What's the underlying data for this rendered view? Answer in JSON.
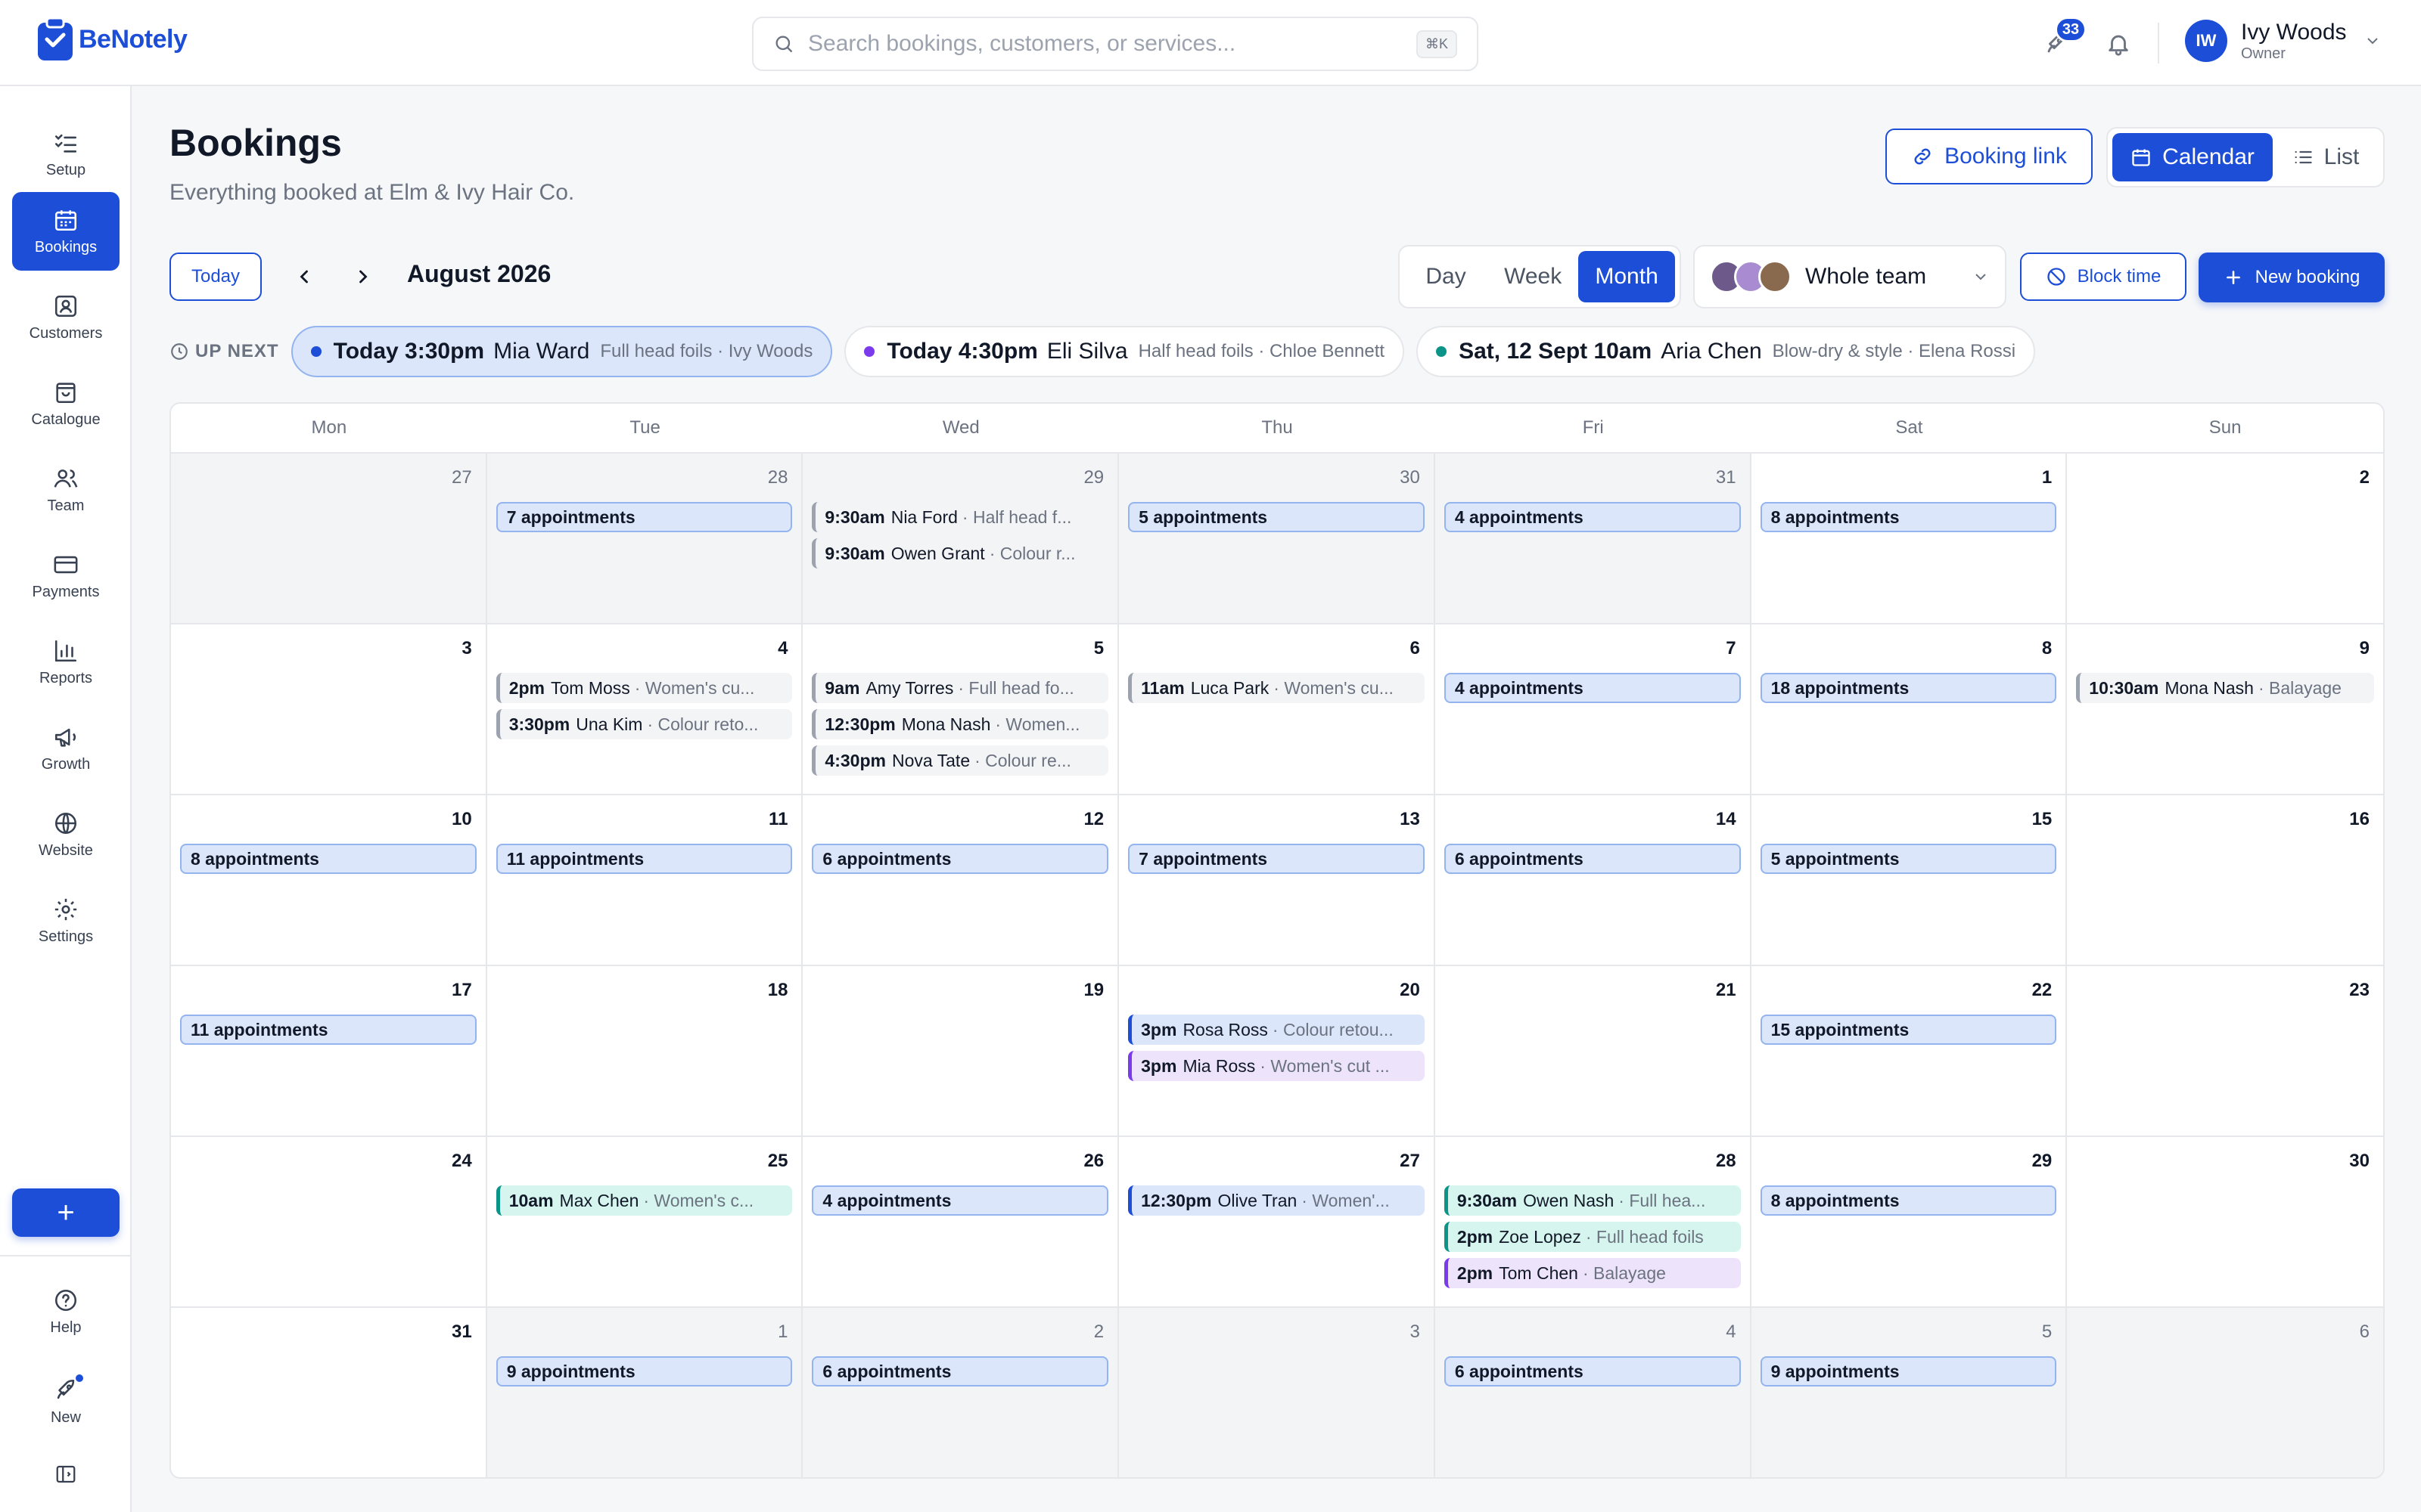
{
  "app": {
    "name": "BeNotely"
  },
  "search": {
    "placeholder": "Search bookings, customers, or services...",
    "shortcut": "⌘K"
  },
  "topbar": {
    "notifications_count": "33"
  },
  "user": {
    "initials": "IW",
    "name": "Ivy Woods",
    "role": "Owner"
  },
  "sidebar": {
    "items": [
      {
        "label": "Setup",
        "icon": "checklist-icon"
      },
      {
        "label": "Bookings",
        "icon": "calendar-icon"
      },
      {
        "label": "Customers",
        "icon": "contact-card-icon"
      },
      {
        "label": "Catalogue",
        "icon": "shopping-bag-icon"
      },
      {
        "label": "Team",
        "icon": "users-icon"
      },
      {
        "label": "Payments",
        "icon": "credit-card-icon"
      },
      {
        "label": "Reports",
        "icon": "bar-chart-icon"
      },
      {
        "label": "Growth",
        "icon": "megaphone-icon"
      },
      {
        "label": "Website",
        "icon": "globe-icon"
      },
      {
        "label": "Settings",
        "icon": "gear-icon"
      }
    ],
    "add_label": "+",
    "help_label": "Help",
    "new_label": "New"
  },
  "page": {
    "title": "Bookings",
    "subtitle": "Everything booked at Elm & Ivy Hair Co.",
    "booking_link_label": "Booking link",
    "calendar_label": "Calendar",
    "list_label": "List"
  },
  "toolbar": {
    "today_label": "Today",
    "month_label": "August 2026",
    "views": [
      "Day",
      "Week",
      "Month"
    ],
    "active_view": "Month",
    "team_label": "Whole team",
    "block_time_label": "Block time",
    "new_booking_label": "New booking"
  },
  "up_next": {
    "label": "UP NEXT",
    "items": [
      {
        "when": "Today 3:30pm",
        "who": "Mia Ward",
        "what": "Full head foils · Ivy Woods",
        "color": "#1d4ed8"
      },
      {
        "when": "Today 4:30pm",
        "who": "Eli Silva",
        "what": "Half head foils · Chloe Bennett",
        "color": "#7c3aed"
      },
      {
        "when": "Sat, 12 Sept 10am",
        "who": "Aria Chen",
        "what": "Blow-dry & style · Elena Rossi",
        "color": "#0d9488"
      }
    ]
  },
  "calendar": {
    "weekdays": [
      "Mon",
      "Tue",
      "Wed",
      "Thu",
      "Fri",
      "Sat",
      "Sun"
    ],
    "weeks": [
      [
        {
          "day": "27",
          "muted": true,
          "events": []
        },
        {
          "day": "28",
          "muted": true,
          "events": [
            {
              "summary": "7 appointments"
            }
          ]
        },
        {
          "day": "29",
          "muted": true,
          "events": [
            {
              "time": "9:30am",
              "name": "Nia Ford",
              "service": "· Half head f...",
              "color": "grey"
            },
            {
              "time": "9:30am",
              "name": "Owen Grant",
              "service": "· Colour r...",
              "color": "grey"
            }
          ]
        },
        {
          "day": "30",
          "muted": true,
          "events": [
            {
              "summary": "5 appointments"
            }
          ]
        },
        {
          "day": "31",
          "muted": true,
          "events": [
            {
              "summary": "4 appointments"
            }
          ]
        },
        {
          "day": "1",
          "muted": false,
          "events": [
            {
              "summary": "8 appointments"
            }
          ]
        },
        {
          "day": "2",
          "muted": false,
          "events": []
        }
      ],
      [
        {
          "day": "3",
          "muted": false,
          "events": []
        },
        {
          "day": "4",
          "muted": false,
          "events": [
            {
              "time": "2pm",
              "name": "Tom Moss",
              "service": "· Women's cu...",
              "color": "grey"
            },
            {
              "time": "3:30pm",
              "name": "Una Kim",
              "service": "· Colour reto...",
              "color": "grey"
            }
          ]
        },
        {
          "day": "5",
          "muted": false,
          "events": [
            {
              "time": "9am",
              "name": "Amy Torres",
              "service": "· Full head fo...",
              "color": "grey"
            },
            {
              "time": "12:30pm",
              "name": "Mona Nash",
              "service": "· Women...",
              "color": "grey"
            },
            {
              "time": "4:30pm",
              "name": "Nova Tate",
              "service": "· Colour re...",
              "color": "grey"
            }
          ]
        },
        {
          "day": "6",
          "muted": false,
          "events": [
            {
              "time": "11am",
              "name": "Luca Park",
              "service": "· Women's cu...",
              "color": "grey"
            }
          ]
        },
        {
          "day": "7",
          "muted": false,
          "events": [
            {
              "summary": "4 appointments"
            }
          ]
        },
        {
          "day": "8",
          "muted": false,
          "events": [
            {
              "summary": "18 appointments"
            }
          ]
        },
        {
          "day": "9",
          "muted": false,
          "events": [
            {
              "time": "10:30am",
              "name": "Mona Nash",
              "service": "· Balayage",
              "color": "grey"
            }
          ]
        }
      ],
      [
        {
          "day": "10",
          "muted": false,
          "events": [
            {
              "summary": "8 appointments"
            }
          ]
        },
        {
          "day": "11",
          "muted": false,
          "events": [
            {
              "summary": "11 appointments"
            }
          ]
        },
        {
          "day": "12",
          "muted": false,
          "events": [
            {
              "summary": "6 appointments"
            }
          ]
        },
        {
          "day": "13",
          "muted": false,
          "events": [
            {
              "summary": "7 appointments"
            }
          ]
        },
        {
          "day": "14",
          "muted": false,
          "events": [
            {
              "summary": "6 appointments"
            }
          ]
        },
        {
          "day": "15",
          "muted": false,
          "events": [
            {
              "summary": "5 appointments"
            }
          ]
        },
        {
          "day": "16",
          "muted": false,
          "events": []
        }
      ],
      [
        {
          "day": "17",
          "muted": false,
          "events": [
            {
              "summary": "11 appointments"
            }
          ]
        },
        {
          "day": "18",
          "muted": false,
          "events": []
        },
        {
          "day": "19",
          "muted": false,
          "events": []
        },
        {
          "day": "20",
          "muted": false,
          "events": [
            {
              "time": "3pm",
              "name": "Rosa Ross",
              "service": "· Colour retou...",
              "color": "blue"
            },
            {
              "time": "3pm",
              "name": "Mia Ross",
              "service": "· Women's cut ...",
              "color": "purple"
            }
          ]
        },
        {
          "day": "21",
          "muted": false,
          "events": []
        },
        {
          "day": "22",
          "muted": false,
          "events": [
            {
              "summary": "15 appointments"
            }
          ]
        },
        {
          "day": "23",
          "muted": false,
          "events": []
        }
      ],
      [
        {
          "day": "24",
          "muted": false,
          "events": []
        },
        {
          "day": "25",
          "muted": false,
          "events": [
            {
              "time": "10am",
              "name": "Max Chen",
              "service": "· Women's c...",
              "color": "teal"
            }
          ]
        },
        {
          "day": "26",
          "muted": false,
          "events": [
            {
              "summary": "4 appointments"
            }
          ]
        },
        {
          "day": "27",
          "muted": false,
          "events": [
            {
              "time": "12:30pm",
              "name": "Olive Tran",
              "service": "· Women'...",
              "color": "blue"
            }
          ]
        },
        {
          "day": "28",
          "muted": false,
          "events": [
            {
              "time": "9:30am",
              "name": "Owen Nash",
              "service": "· Full hea...",
              "color": "teal"
            },
            {
              "time": "2pm",
              "name": "Zoe Lopez",
              "service": "· Full head foils",
              "color": "teal"
            },
            {
              "time": "2pm",
              "name": "Tom Chen",
              "service": "· Balayage",
              "color": "purple"
            }
          ]
        },
        {
          "day": "29",
          "muted": false,
          "events": [
            {
              "summary": "8 appointments"
            }
          ]
        },
        {
          "day": "30",
          "muted": false,
          "events": []
        }
      ],
      [
        {
          "day": "31",
          "muted": false,
          "events": []
        },
        {
          "day": "1",
          "muted": true,
          "events": [
            {
              "summary": "9 appointments"
            }
          ]
        },
        {
          "day": "2",
          "muted": true,
          "events": [
            {
              "summary": "6 appointments"
            }
          ]
        },
        {
          "day": "3",
          "muted": true,
          "events": []
        },
        {
          "day": "4",
          "muted": true,
          "events": [
            {
              "summary": "6 appointments"
            }
          ]
        },
        {
          "day": "5",
          "muted": true,
          "events": [
            {
              "summary": "9 appointments"
            }
          ]
        },
        {
          "day": "6",
          "muted": true,
          "events": []
        }
      ]
    ]
  },
  "colors": {
    "accent": "#1d4ed8",
    "purple": "#7c3aed",
    "teal": "#0d9488"
  }
}
